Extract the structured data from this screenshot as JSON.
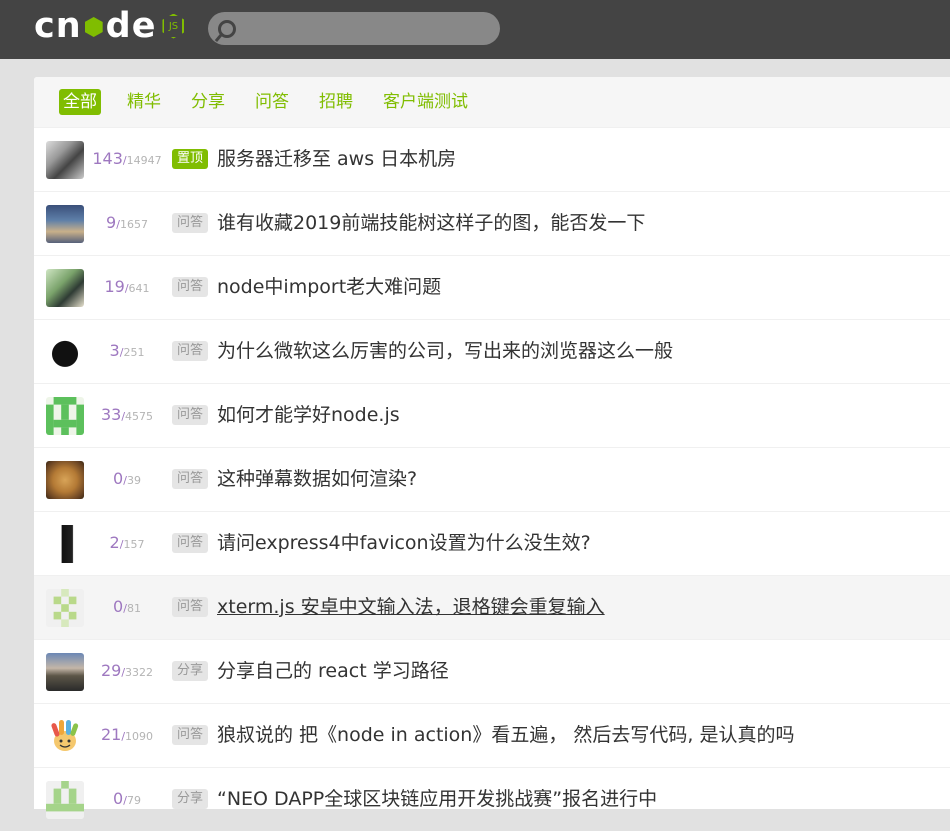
{
  "navbar": {
    "logo_text": "cnode",
    "logo_badge": "JS",
    "search": {
      "placeholder": "",
      "value": ""
    }
  },
  "tabs": [
    {
      "label": "全部",
      "active": true
    },
    {
      "label": "精华",
      "active": false
    },
    {
      "label": "分享",
      "active": false
    },
    {
      "label": "问答",
      "active": false
    },
    {
      "label": "招聘",
      "active": false
    },
    {
      "label": "客户端测试",
      "active": false
    }
  ],
  "topics": [
    {
      "reply": "143",
      "visit": "14947",
      "tag": "置顶",
      "title": "服务器迁移至 aws 日本机房"
    },
    {
      "reply": "9",
      "visit": "1657",
      "tag": "问答",
      "title": "谁有收藏2019前端技能树这样子的图，能否发一下"
    },
    {
      "reply": "19",
      "visit": "641",
      "tag": "问答",
      "title": "node中import老大难问题"
    },
    {
      "reply": "3",
      "visit": "251",
      "tag": "问答",
      "title": "为什么微软这么厉害的公司，写出来的浏览器这么一般"
    },
    {
      "reply": "33",
      "visit": "4575",
      "tag": "问答",
      "title": "如何才能学好node.js"
    },
    {
      "reply": "0",
      "visit": "39",
      "tag": "问答",
      "title": "这种弹幕数据如何渲染?"
    },
    {
      "reply": "2",
      "visit": "157",
      "tag": "问答",
      "title": "请问express4中favicon设置为什么没生效?"
    },
    {
      "reply": "0",
      "visit": "81",
      "tag": "问答",
      "title": "xterm.js 安卓中文输入法，退格键会重复输入"
    },
    {
      "reply": "29",
      "visit": "3322",
      "tag": "分享",
      "title": "分享自己的 react 学习路径"
    },
    {
      "reply": "21",
      "visit": "1090",
      "tag": "问答",
      "title": "狼叔说的 把《node in action》看五遍， 然后去写代码, 是认真的吗"
    },
    {
      "reply": "0",
      "visit": "79",
      "tag": "分享",
      "title": "“NEO DAPP全球区块链应用开发挑战赛”报名进行中"
    }
  ],
  "separator": "/",
  "colors": {
    "accent": "#80bd01",
    "reply": "#9e78c0",
    "navbar": "#444444"
  }
}
